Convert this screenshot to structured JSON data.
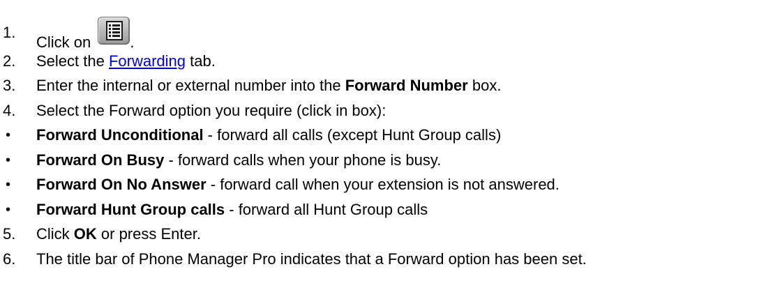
{
  "steps": [
    {
      "num": "1.",
      "text_before": "Click on ",
      "text_after": ".",
      "icon": "list-window-icon"
    },
    {
      "num": "2.",
      "before": "Select the ",
      "link": "Forwarding",
      "after": " tab."
    },
    {
      "num": "3.",
      "before": "Enter the internal or external number into the ",
      "bold": "Forward Number",
      "after": " box."
    },
    {
      "num": "4.",
      "text": "Select the Forward option you require (click in box):"
    },
    {
      "num": "5.",
      "before": "Click ",
      "bold": "OK",
      "after": " or press Enter."
    },
    {
      "num": "6.",
      "text": "The title bar of Phone Manager Pro indicates that a Forward option has been set."
    }
  ],
  "bullets": [
    {
      "marker": "•",
      "bold": "Forward Unconditional",
      "text": " - forward all calls (except Hunt Group calls)"
    },
    {
      "marker": "•",
      "bold": "Forward On Busy",
      "text": " - forward calls when your phone is busy."
    },
    {
      "marker": "•",
      "bold": "Forward On No Answer",
      "text": " - forward call when your extension is not answered."
    },
    {
      "marker": "•",
      "bold": "Forward Hunt Group calls",
      "text": " - forward all Hunt Group calls"
    }
  ]
}
